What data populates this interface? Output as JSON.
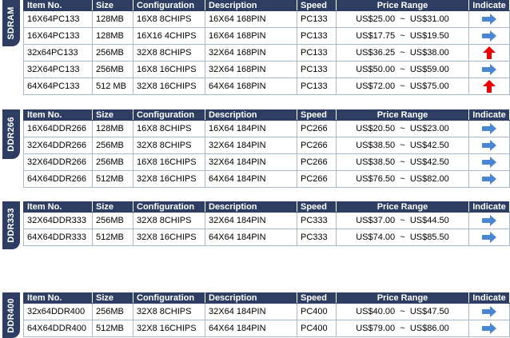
{
  "headers": {
    "item": "Item No.",
    "size": "Size",
    "config": "Configuration",
    "desc": "Description",
    "speed": "Speed",
    "price": "Price Range",
    "ind": "Indicate"
  },
  "colors": {
    "header_bg": "#2e3e63",
    "arrow_right": "#4a86d4",
    "arrow_up": "#ee0000",
    "border": "#a9b8cc"
  },
  "sections": [
    {
      "label": "SDRAM",
      "rows": [
        {
          "item": "16X64PC133",
          "size": "128MB",
          "config": "16X8 8CHIPS",
          "desc": "16X64 168PIN",
          "speed": "PC133",
          "low": "US$25.00",
          "high": "US$31.00",
          "ind": "arrow-right-icon"
        },
        {
          "item": "16X64PC133",
          "size": "128MB",
          "config": "16X16 4CHIPS",
          "desc": "16X64 168PIN",
          "speed": "PC133",
          "low": "US$17.75",
          "high": "US$19.50",
          "ind": "arrow-right-icon"
        },
        {
          "item": "32x64PC133",
          "size": "256MB",
          "config": "32X8 8CHIPS",
          "desc": "32X64 168PIN",
          "speed": "PC133",
          "low": "US$36.25",
          "high": "US$38.00",
          "ind": "arrow-up-icon"
        },
        {
          "item": "32X64PC133",
          "size": "256MB",
          "config": "16X8 16CHIPS",
          "desc": "32X64 168PIN",
          "speed": "PC133",
          "low": "US$50.00",
          "high": "US$59.00",
          "ind": "arrow-right-icon"
        },
        {
          "item": "64X64PC133",
          "size": "512 MB",
          "config": "32X8 16CHIPS",
          "desc": "64X64 168PIN",
          "speed": "PC133",
          "low": "US$72.00",
          "high": "US$75.00",
          "ind": "arrow-up-icon"
        }
      ]
    },
    {
      "label": "DDR266",
      "rows": [
        {
          "item": "16X64DDR266",
          "size": "128MB",
          "config": "16X8 8CHIPS",
          "desc": "16X64 184PIN",
          "speed": "PC266",
          "low": "US$20.50",
          "high": "US$23.00",
          "ind": "arrow-right-icon"
        },
        {
          "item": "32X64DDR266",
          "size": "256MB",
          "config": "32X8 8CHIPS",
          "desc": "32X64 184PIN",
          "speed": "PC266",
          "low": "US$38.50",
          "high": "US$42.50",
          "ind": "arrow-right-icon"
        },
        {
          "item": "32X64DDR266",
          "size": "256MB",
          "config": "16X8 16CHIPS",
          "desc": "32X64 184PIN",
          "speed": "PC266",
          "low": "US$38.50",
          "high": "US$42.50",
          "ind": "arrow-right-icon"
        },
        {
          "item": "64X64DDR266",
          "size": "512MB",
          "config": "32X8 16CHIPS",
          "desc": "64X64 184PIN",
          "speed": "PC266",
          "low": "US$76.50",
          "high": "US$82.00",
          "ind": "arrow-right-icon"
        }
      ]
    },
    {
      "label": "DDR333",
      "rows": [
        {
          "item": "32X64DDR333",
          "size": "256MB",
          "config": "32X8 8CHIPS",
          "desc": "32X64 184PIN",
          "speed": "PC333",
          "low": "US$37.00",
          "high": "US$44.50",
          "ind": "arrow-right-icon"
        },
        {
          "item": "64X64DDR333",
          "size": "512MB",
          "config": "32X8 16CHIPS",
          "desc": "64X64 184PIN",
          "speed": "PC333",
          "low": "US$74.00",
          "high": "US$85.50",
          "ind": "arrow-right-icon"
        }
      ]
    },
    {
      "label": "DDR400",
      "rows": [
        {
          "item": "32x64DDR400",
          "size": "256MB",
          "config": "32X8 8CHIPS",
          "desc": "32X64 184PIN",
          "speed": "PC400",
          "low": "US$40.00",
          "high": "US$47.50",
          "ind": "arrow-right-icon"
        },
        {
          "item": "64X64DDR400",
          "size": "512MB",
          "config": "32X8 16CHIPS",
          "desc": "64X64 184PIN",
          "speed": "PC400",
          "low": "US$79.00",
          "high": "US$86.00",
          "ind": "arrow-right-icon"
        }
      ]
    }
  ]
}
